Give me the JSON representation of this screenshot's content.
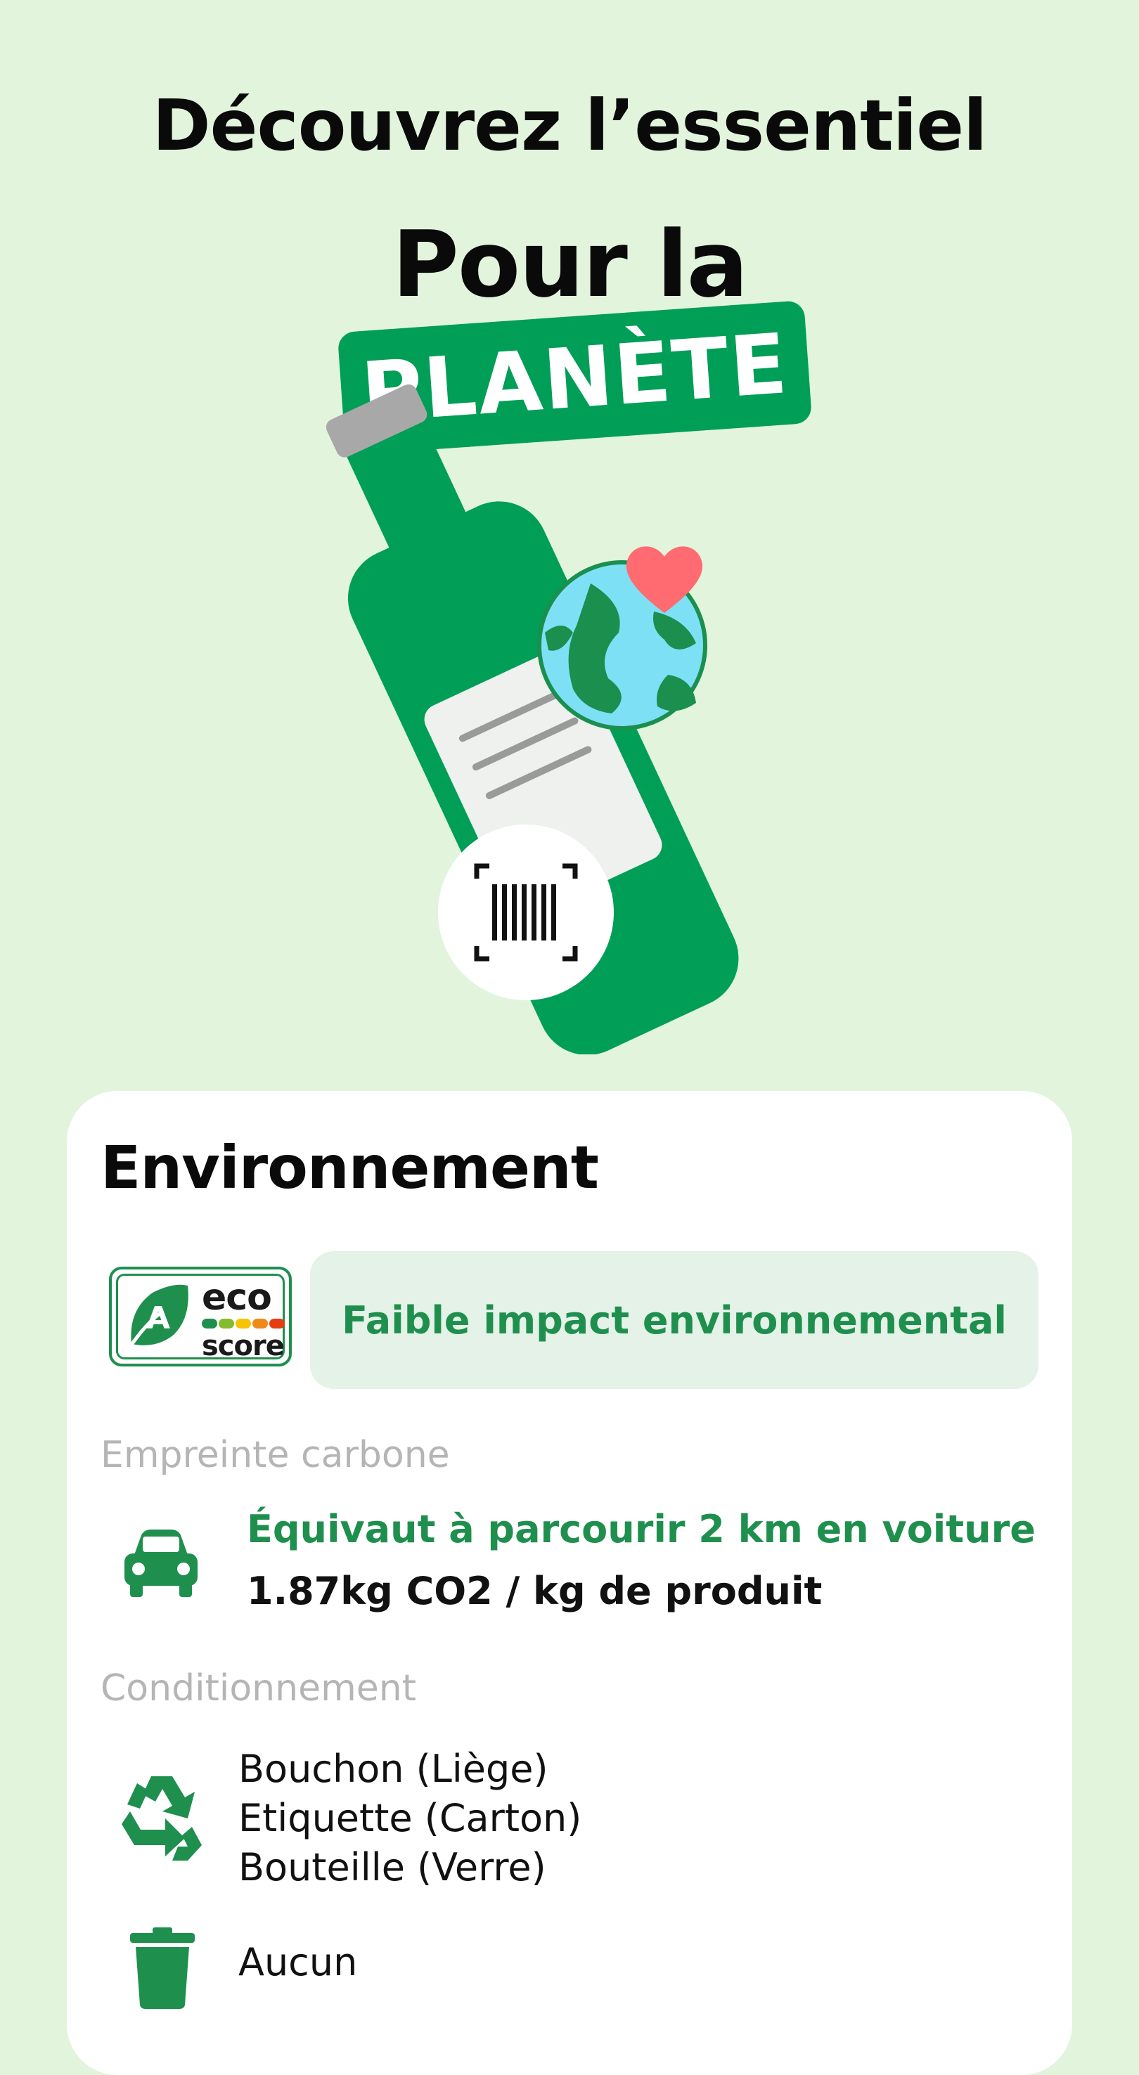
{
  "hero": {
    "headline": "Découvrez l’essentiel",
    "subline": "Pour la",
    "tag": "PLANÈTE"
  },
  "card": {
    "title": "Environnement",
    "ecoscore": {
      "grade": "A",
      "word": "eco",
      "score_word": "score",
      "stripe_colors": [
        "#1f8f4e",
        "#85bb2f",
        "#f7c400",
        "#ef8a19",
        "#e63e11"
      ]
    },
    "impact_label": "Faible impact environnemental",
    "carbon": {
      "label": "Empreinte carbone",
      "equivalent": "Équivaut à parcourir 2 km en voiture",
      "value": "1.87kg CO2 / kg de produit"
    },
    "packaging": {
      "label": "Conditionnement",
      "recyclable": [
        "Bouchon (Liège)",
        "Etiquette (Carton)",
        "Bouteille (Verre)"
      ],
      "non_recyclable": "Aucun"
    }
  },
  "colors": {
    "background": "#e2f5dc",
    "brand_green": "#009e57",
    "text_green": "#1f8f4e"
  }
}
